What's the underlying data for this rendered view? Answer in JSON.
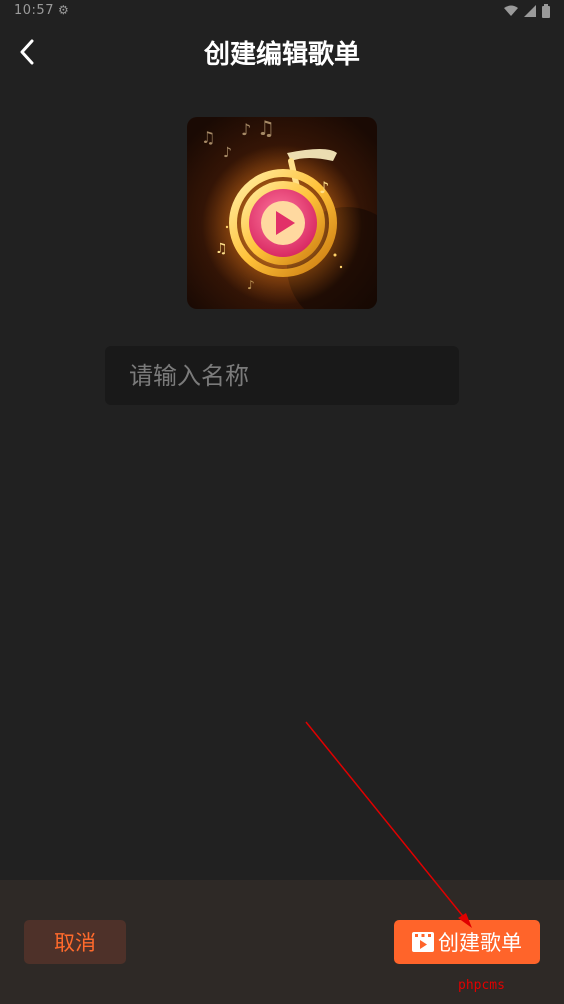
{
  "status_bar": {
    "time": "10:57",
    "icons": [
      "settings-gear-icon",
      "wifi-icon",
      "signal-icon",
      "battery-icon"
    ]
  },
  "header": {
    "title": "创建编辑歌单",
    "back_icon": "chevron-left-icon"
  },
  "cover": {
    "icon": "music-play-disc-icon"
  },
  "name_input": {
    "placeholder": "请输入名称",
    "value": ""
  },
  "footer": {
    "cancel_label": "取消",
    "create_label": "创建歌单",
    "create_icon": "video-play-icon"
  },
  "watermark": "phpcms",
  "colors": {
    "accent": "#ff642a",
    "background": "#212121",
    "bottom_bar": "#2e2926",
    "annotation": "#e00000"
  }
}
